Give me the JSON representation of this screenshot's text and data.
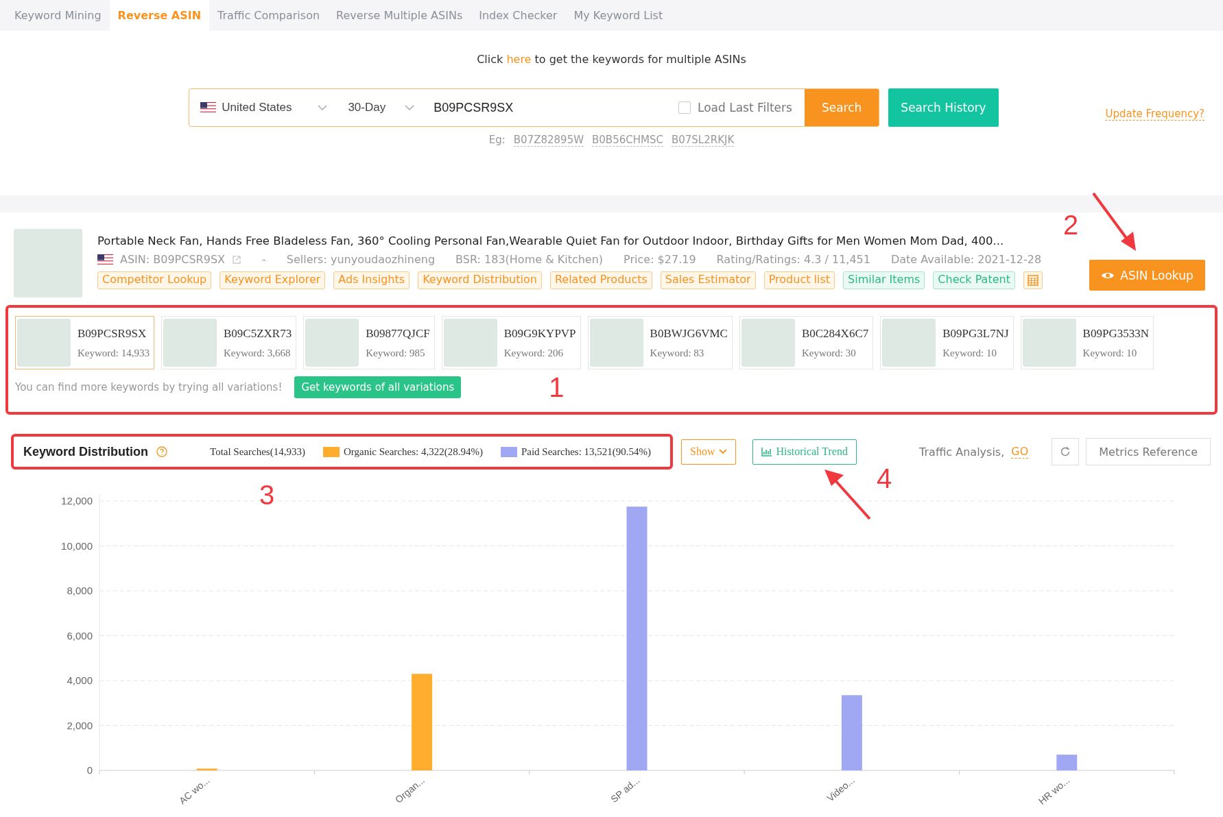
{
  "tabs": [
    {
      "label": "Keyword Mining",
      "selected": false
    },
    {
      "label": "Reverse ASIN",
      "selected": true
    },
    {
      "label": "Traffic Comparison",
      "selected": false
    },
    {
      "label": "Reverse Multiple ASINs",
      "selected": false
    },
    {
      "label": "Index Checker",
      "selected": false
    },
    {
      "label": "My Keyword List",
      "selected": false
    }
  ],
  "hint": {
    "before": "Click",
    "link": "here",
    "after": "to get the keywords for multiple ASINs"
  },
  "search": {
    "country": "United States",
    "period": "30-Day",
    "value": "B09PCSR9SX",
    "load_last_filters": {
      "label": "Load Last Filters",
      "checked": false
    },
    "button": "Search",
    "history_button": "Search History",
    "update_link": "Update Frequency?",
    "examples_label": "Eg:",
    "examples": [
      "B07Z82895W",
      "B0B56CHMSC",
      "B07SL2RKJK"
    ]
  },
  "product": {
    "title": "Portable Neck Fan, Hands Free Bladeless Fan, 360° Cooling Personal Fan,Wearable Quiet Fan for Outdoor Indoor, Birthday Gifts for Men Women Mom Dad, 400...",
    "asin": "ASIN: B09PCSR9SX",
    "separator": "-",
    "meta": [
      "Sellers: yunyoudaozhineng",
      "BSR: 183(Home & Kitchen)",
      "Price: $27.19",
      "Rating/Ratings: 4.3 / 11,451",
      "Date Available: 2021-12-28"
    ],
    "tools": [
      {
        "label": "Competitor Lookup",
        "kind": "orange"
      },
      {
        "label": "Keyword Explorer",
        "kind": "orange"
      },
      {
        "label": "Ads Insights",
        "kind": "orange"
      },
      {
        "label": "Keyword Distribution",
        "kind": "orange"
      },
      {
        "label": "Related Products",
        "kind": "orange"
      },
      {
        "label": "Sales Estimator",
        "kind": "orange"
      },
      {
        "label": "Product list",
        "kind": "orange"
      },
      {
        "label": "Similar Items",
        "kind": "green"
      },
      {
        "label": "Check Patent",
        "kind": "green"
      }
    ],
    "lookup_button": "ASIN Lookup"
  },
  "variations": {
    "items": [
      {
        "asin": "B09PCSR9SX",
        "keywords": "Keyword: 14,933",
        "selected": true
      },
      {
        "asin": "B09C5ZXR73",
        "keywords": "Keyword: 3,668",
        "selected": false
      },
      {
        "asin": "B09877QJCF",
        "keywords": "Keyword: 985",
        "selected": false
      },
      {
        "asin": "B09G9KYPVP",
        "keywords": "Keyword: 206",
        "selected": false
      },
      {
        "asin": "B0BWJG6VMC",
        "keywords": "Keyword: 83",
        "selected": false
      },
      {
        "asin": "B0C284X6C7",
        "keywords": "Keyword: 30",
        "selected": false
      },
      {
        "asin": "B09PG3L7NJ",
        "keywords": "Keyword: 10",
        "selected": false
      },
      {
        "asin": "B09PG3533N",
        "keywords": "Keyword: 10",
        "selected": false
      }
    ],
    "note": "You can find more keywords by trying all variations!",
    "button": "Get keywords of all variations"
  },
  "distribution": {
    "title": "Keyword Distribution",
    "total": "Total Searches(14,933)",
    "legend": [
      ": 4,322(28.94%)",
      ": 13,521(90.54%)"
    ],
    "show_button": "Show",
    "trend_button": "Historical Trend",
    "traffic_label": "Traffic Analysis,",
    "traffic_link": "GO",
    "metrics_button": "Metrics Reference",
    "chart_data": {
      "type": "bar",
      "categories": [
        "AC wo...",
        "Organ...",
        "SP ad...",
        "Video...",
        "HR wo..."
      ],
      "series": [
        {
          "name": "Organic Searches",
          "color": "#ffad2e",
          "values": [
            80,
            4300,
            null,
            null,
            null
          ]
        },
        {
          "name": "Paid Searches",
          "color": "#a0a8f4",
          "values": [
            null,
            null,
            11750,
            3350,
            700
          ]
        }
      ],
      "ylim": [
        0,
        12000
      ],
      "grid": true,
      "yticks": [
        {
          "value": 0,
          "label": "0"
        },
        {
          "value": 2000,
          "label": "2,000"
        },
        {
          "value": 4000,
          "label": "4,000"
        },
        {
          "value": 6000,
          "label": "6,000"
        },
        {
          "value": 8000,
          "label": "8,000"
        },
        {
          "value": 10000,
          "label": "10,000"
        },
        {
          "value": 12000,
          "label": "12,000"
        }
      ]
    }
  },
  "annotations": [
    "1",
    "2",
    "3",
    "4"
  ]
}
